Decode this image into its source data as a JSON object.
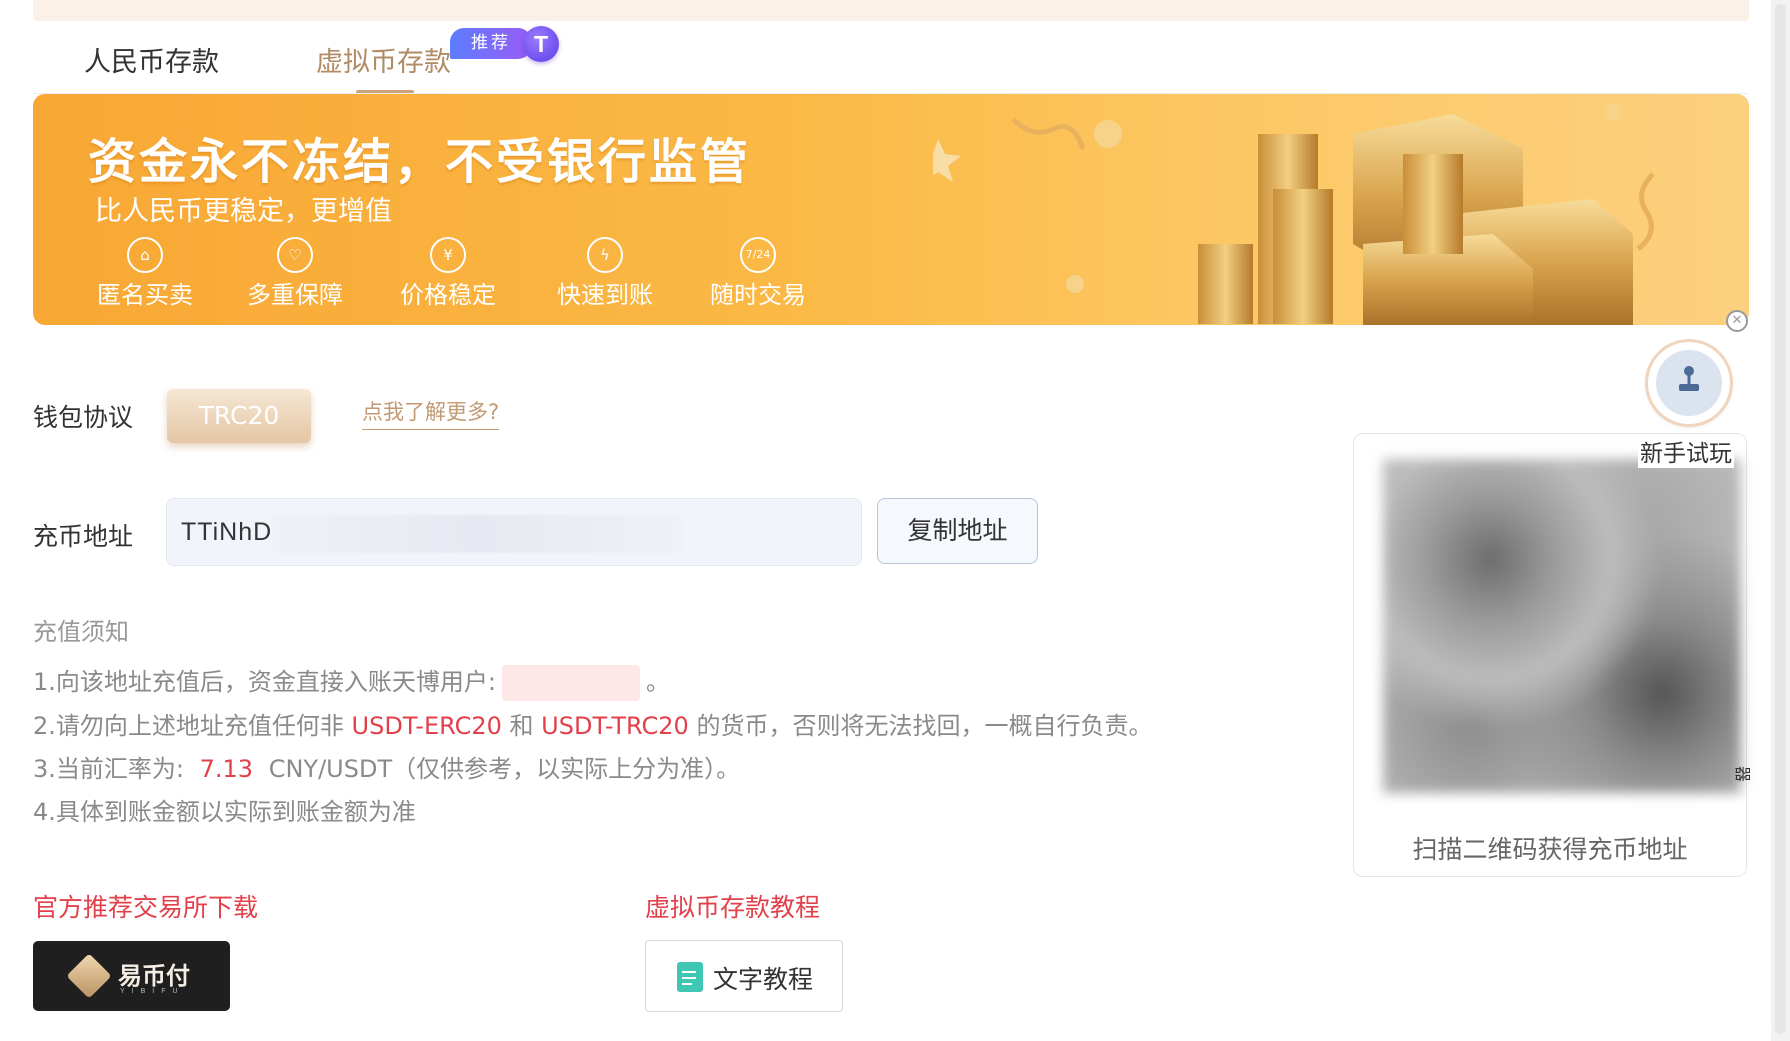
{
  "tabs": {
    "rmb_deposit": "人民币存款",
    "crypto_deposit": "虚拟币存款",
    "recommend_badge": "推荐",
    "tether_icon": "T"
  },
  "banner": {
    "title": "资金永不冻结，不受银行监管",
    "subtitle": "比人民币更稳定，更增值",
    "features": [
      {
        "icon": "hat-icon",
        "label": "匿名买卖"
      },
      {
        "icon": "shield-icon",
        "label": "多重保障"
      },
      {
        "icon": "yen-icon",
        "label": "价格稳定"
      },
      {
        "icon": "lightning-icon",
        "label": "快速到账"
      },
      {
        "icon": "clock-24-icon",
        "label": "随时交易"
      }
    ],
    "feature_glyphs": [
      "⌂",
      "♡",
      "¥",
      "ϟ",
      "7/24"
    ]
  },
  "wallet": {
    "protocol_label": "钱包协议",
    "protocol_value": "TRC20",
    "learn_more": "点我了解更多?"
  },
  "address": {
    "label": "充币地址",
    "value": "TTiNhD",
    "copy_button": "复制地址"
  },
  "notice": {
    "title": "充值须知",
    "line1_a": "1.向该地址充值后，资金直接入账天博用户:",
    "line1_b": "。",
    "line2_a": "2.请勿向上述地址充值任何非",
    "line2_erc": "USDT-ERC20",
    "line2_and": "和",
    "line2_trc": "USDT-TRC20",
    "line2_b": "的货币，否则将无法找回，一概自行负责。",
    "line3_a": "3.当前汇率为:",
    "line3_rate": "7.13",
    "line3_b": "CNY/USDT（仅供参考，以实际上分为准）。",
    "line4": "4.具体到账金额以实际到账金额为准"
  },
  "downloads": {
    "exchange_title": "官方推荐交易所下载",
    "exchange_name": "易币付",
    "exchange_sub": "YIBIFU",
    "tutorial_title": "虚拟币存款教程",
    "tutorial_button": "文字教程"
  },
  "qr": {
    "caption": "扫描二维码获得充币地址"
  },
  "floating": {
    "trial_label": "新手试玩",
    "side_char": "器"
  },
  "colors": {
    "accent_gold": "#c9a37b",
    "banner_orange": "#f8a734",
    "warning_red": "#e2404a"
  }
}
